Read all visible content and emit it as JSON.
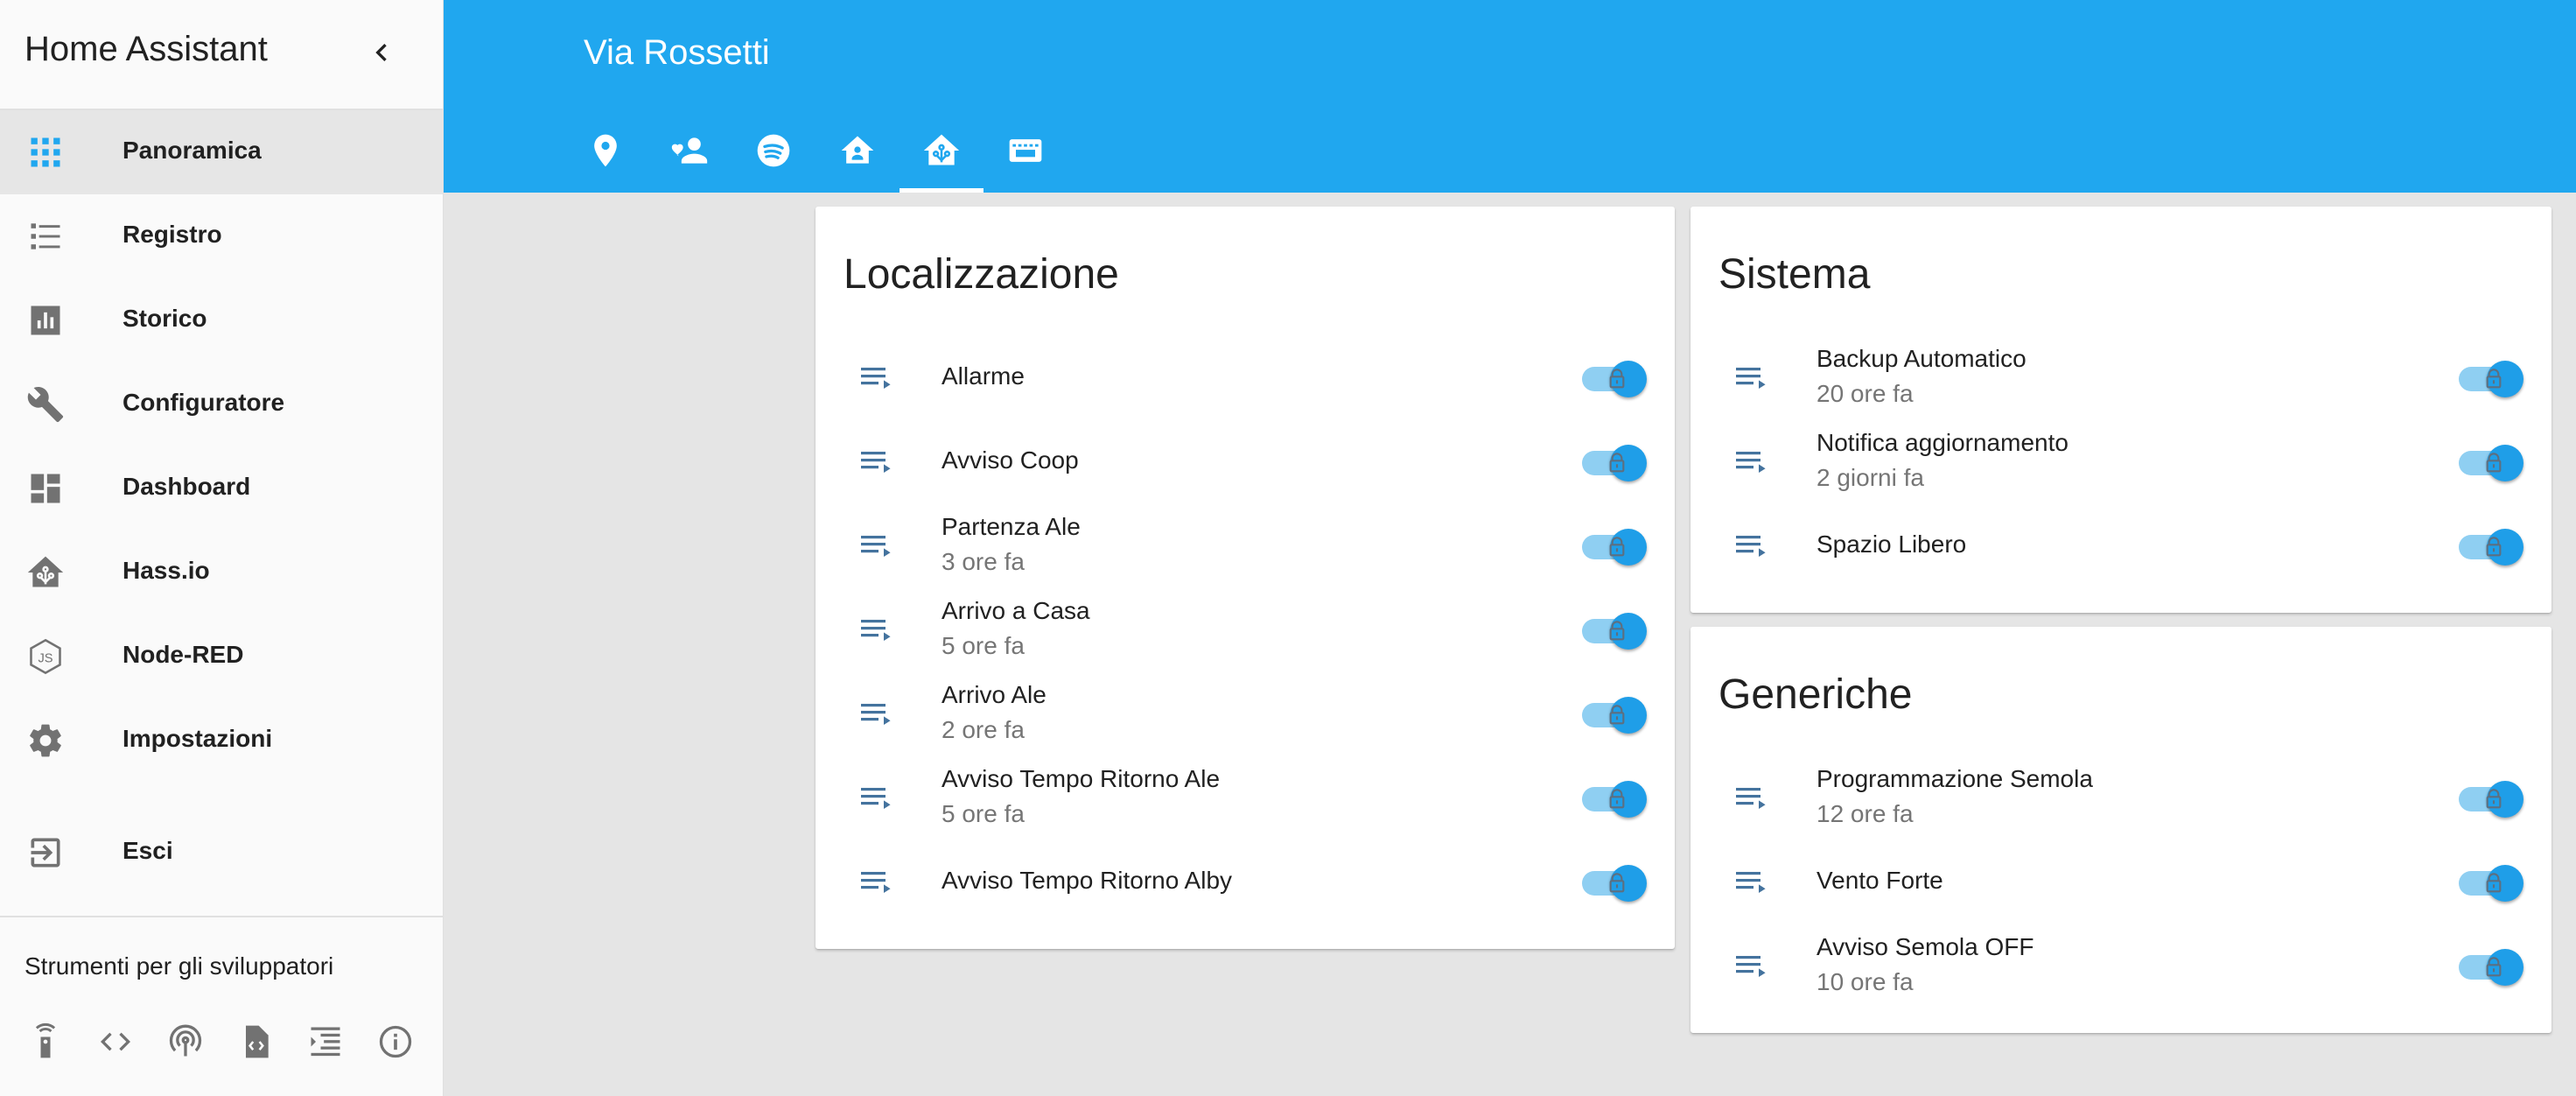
{
  "sidebar": {
    "title": "Home Assistant",
    "items": [
      {
        "label": "Panoramica",
        "icon": "grid-icon",
        "active": true
      },
      {
        "label": "Registro",
        "icon": "list-icon"
      },
      {
        "label": "Storico",
        "icon": "chart-icon"
      },
      {
        "label": "Configuratore",
        "icon": "wrench-icon"
      },
      {
        "label": "Dashboard",
        "icon": "dashboard-icon"
      },
      {
        "label": "Hass.io",
        "icon": "hassio-icon"
      },
      {
        "label": "Node-RED",
        "icon": "nodejs-icon"
      },
      {
        "label": "Impostazioni",
        "icon": "gear-icon"
      },
      {
        "label": "Esci",
        "icon": "logout-icon"
      }
    ],
    "dev_tools_title": "Strumenti per gli sviluppatori",
    "dev_tools": [
      "remote-icon",
      "code-icon",
      "broadcast-icon",
      "file-code-icon",
      "template-icon",
      "info-icon"
    ]
  },
  "header": {
    "title": "Via Rossetti",
    "tabs": [
      "map-marker-icon",
      "account-heart-icon",
      "spotify-icon",
      "home-account-icon",
      "home-assistant-icon",
      "video-input-icon"
    ],
    "active_tab": 4
  },
  "cards": {
    "localizzazione": {
      "title": "Localizzazione",
      "rows": [
        {
          "name": "Allarme",
          "sub": ""
        },
        {
          "name": "Avviso Coop",
          "sub": ""
        },
        {
          "name": "Partenza Ale",
          "sub": "3 ore fa"
        },
        {
          "name": "Arrivo a Casa",
          "sub": "5 ore fa"
        },
        {
          "name": "Arrivo Ale",
          "sub": "2 ore fa"
        },
        {
          "name": "Avviso Tempo Ritorno Ale",
          "sub": "5 ore fa"
        },
        {
          "name": "Avviso Tempo Ritorno Alby",
          "sub": ""
        }
      ]
    },
    "sistema": {
      "title": "Sistema",
      "rows": [
        {
          "name": "Backup Automatico",
          "sub": "20 ore fa"
        },
        {
          "name": "Notifica aggiornamento",
          "sub": "2 giorni fa"
        },
        {
          "name": "Spazio Libero",
          "sub": ""
        }
      ]
    },
    "generiche": {
      "title": "Generiche",
      "rows": [
        {
          "name": "Programmazione Semola",
          "sub": "12 ore fa"
        },
        {
          "name": "Vento Forte",
          "sub": ""
        },
        {
          "name": "Avviso Semola OFF",
          "sub": "10 ore fa"
        }
      ]
    }
  },
  "colors": {
    "accent": "#20a7ef",
    "icon": "#44739e",
    "toggle": "#1f9ee8"
  }
}
